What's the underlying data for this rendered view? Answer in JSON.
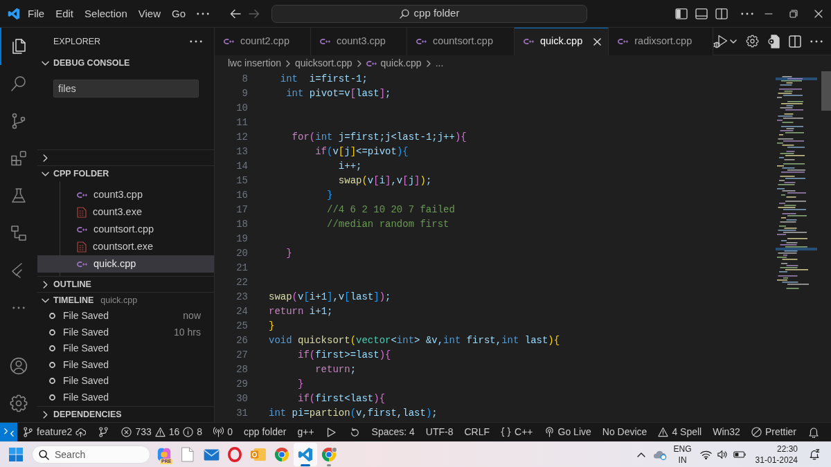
{
  "title_bar": {
    "menu": [
      "File",
      "Edit",
      "Selection",
      "View",
      "Go"
    ],
    "back": {
      "disabled": false
    },
    "forward": {
      "disabled": true
    },
    "command_center": "cpp folder"
  },
  "activity_bar": [
    {
      "selected": true
    },
    {
      "selected": false
    },
    {
      "selected": false
    },
    {
      "selected": false
    },
    {
      "selected": false
    },
    {
      "selected": false
    },
    {
      "selected": false
    }
  ],
  "sidebar": {
    "title": "EXPLORER",
    "sections": [
      {
        "title": "DEBUG CONSOLE",
        "expanded": true,
        "filter": "files"
      },
      {
        "expanded": false
      },
      {
        "title": "CPP FOLDER",
        "expanded": true,
        "files": [
          {
            "name": "count3.cpp",
            "kind": "source",
            "selected": false
          },
          {
            "name": "count3.exe",
            "kind": "binary",
            "selected": false
          },
          {
            "name": "countsort.cpp",
            "kind": "source",
            "selected": false
          },
          {
            "name": "countsort.exe",
            "kind": "binary",
            "selected": false
          },
          {
            "name": "quick.cpp",
            "kind": "source",
            "selected": true
          }
        ]
      },
      {
        "title": "OUTLINE",
        "expanded": false
      },
      {
        "title": "TIMELINE",
        "subtitle": "quick.cpp",
        "expanded": true,
        "entries": [
          {
            "label": "File Saved",
            "time": "now"
          },
          {
            "label": "File Saved",
            "time": "10 hrs"
          },
          {
            "label": "File Saved"
          },
          {
            "label": "File Saved"
          },
          {
            "label": "File Saved"
          },
          {
            "label": "File Saved"
          }
        ]
      },
      {
        "title": "DEPENDENCIES",
        "expanded": false
      }
    ]
  },
  "editor": {
    "tabs": [
      {
        "name": "count2.cpp",
        "selected": false
      },
      {
        "name": "count3.cpp",
        "selected": false
      },
      {
        "name": "countsort.cpp",
        "selected": false
      },
      {
        "name": "quick.cpp",
        "selected": true
      },
      {
        "name": "radixsort.cpp",
        "selected": false
      }
    ],
    "breadcrumb": [
      {
        "kind": "folder",
        "text": "lwc insertion"
      },
      {
        "kind": "folder",
        "text": "quicksort.cpp"
      },
      {
        "kind": "file",
        "text": "quick.cpp"
      },
      {
        "kind": "more",
        "text": "..."
      }
    ],
    "lines": [
      {
        "number": "8",
        "tokens": [
          {
            "kind": "type",
            "text": "  int"
          },
          {
            "kind": "var",
            "text": "  i=first-1;"
          }
        ]
      },
      {
        "number": "9",
        "tokens": [
          {
            "kind": "type",
            "text": "   int"
          },
          {
            "kind": "var",
            "text": " pivot=v"
          },
          {
            "kind": "bracket2",
            "text": "["
          },
          {
            "kind": "var",
            "text": "last"
          },
          {
            "kind": "bracket2",
            "text": "]"
          },
          {
            "kind": "var",
            "text": ";"
          }
        ]
      },
      {
        "number": "10"
      },
      {
        "number": "11"
      },
      {
        "number": "12",
        "tokens": [
          {
            "kind": "keyword",
            "text": "    for"
          },
          {
            "kind": "bracket2",
            "text": "("
          },
          {
            "kind": "type",
            "text": "int"
          },
          {
            "kind": "var",
            "text": " j=first;j<last-1;j++"
          },
          {
            "kind": "bracket2",
            "text": "){"
          }
        ]
      },
      {
        "number": "13",
        "tokens": [
          {
            "kind": "keyword",
            "text": "        if"
          },
          {
            "kind": "bracket3",
            "text": "("
          },
          {
            "kind": "var",
            "text": "v"
          },
          {
            "kind": "bracket1",
            "text": "["
          },
          {
            "kind": "var",
            "text": "j"
          },
          {
            "kind": "bracket1",
            "text": "]"
          },
          {
            "kind": "var",
            "text": "<=pivot"
          },
          {
            "kind": "bracket3",
            "text": "){"
          }
        ]
      },
      {
        "number": "14",
        "tokens": [
          {
            "kind": "var",
            "text": "            i++;"
          }
        ]
      },
      {
        "number": "15",
        "tokens": [
          {
            "kind": "function",
            "text": "            swap"
          },
          {
            "kind": "bracket1",
            "text": "("
          },
          {
            "kind": "var",
            "text": "v"
          },
          {
            "kind": "bracket2",
            "text": "["
          },
          {
            "kind": "var",
            "text": "i"
          },
          {
            "kind": "bracket2",
            "text": "]"
          },
          {
            "kind": "var",
            "text": ",v"
          },
          {
            "kind": "bracket2",
            "text": "["
          },
          {
            "kind": "var",
            "text": "j"
          },
          {
            "kind": "bracket2",
            "text": "]"
          },
          {
            "kind": "bracket1",
            "text": ")"
          },
          {
            "kind": "var",
            "text": ";"
          }
        ]
      },
      {
        "number": "16",
        "tokens": [
          {
            "kind": "bracket3",
            "text": "          }"
          }
        ]
      },
      {
        "number": "17",
        "tokens": [
          {
            "kind": "comment",
            "text": "          //4 6 2 10 20 7 failed"
          }
        ]
      },
      {
        "number": "18",
        "tokens": [
          {
            "kind": "comment",
            "text": "          //median random first"
          }
        ]
      },
      {
        "number": "19"
      },
      {
        "number": "20",
        "tokens": [
          {
            "kind": "bracket2",
            "text": "   }"
          }
        ]
      },
      {
        "number": "21"
      },
      {
        "number": "22"
      },
      {
        "number": "23",
        "tokens": [
          {
            "kind": "function",
            "text": "swap"
          },
          {
            "kind": "bracket2",
            "text": "("
          },
          {
            "kind": "var",
            "text": "v"
          },
          {
            "kind": "bracket3",
            "text": "["
          },
          {
            "kind": "var",
            "text": "i+1"
          },
          {
            "kind": "bracket3",
            "text": "]"
          },
          {
            "kind": "var",
            "text": ",v"
          },
          {
            "kind": "bracket3",
            "text": "["
          },
          {
            "kind": "var",
            "text": "last"
          },
          {
            "kind": "bracket3",
            "text": "]"
          },
          {
            "kind": "bracket2",
            "text": ")"
          },
          {
            "kind": "var",
            "text": ";"
          }
        ]
      },
      {
        "number": "24",
        "tokens": [
          {
            "kind": "keyword",
            "text": "return"
          },
          {
            "kind": "var",
            "text": " i+1;"
          }
        ]
      },
      {
        "number": "25",
        "tokens": [
          {
            "kind": "bracket1",
            "text": "}"
          }
        ]
      },
      {
        "number": "26",
        "tokens": [
          {
            "kind": "type",
            "text": "void"
          },
          {
            "kind": "function",
            "text": " quicksort"
          },
          {
            "kind": "bracket1",
            "text": "("
          },
          {
            "kind": "class",
            "text": "vector"
          },
          {
            "kind": "var",
            "text": "<"
          },
          {
            "kind": "type",
            "text": "int"
          },
          {
            "kind": "var",
            "text": "> &v,"
          },
          {
            "kind": "type",
            "text": "int"
          },
          {
            "kind": "var",
            "text": " first,"
          },
          {
            "kind": "type",
            "text": "int"
          },
          {
            "kind": "var",
            "text": " last"
          },
          {
            "kind": "bracket1",
            "text": "){"
          }
        ]
      },
      {
        "number": "27",
        "tokens": [
          {
            "kind": "keyword",
            "text": "     if"
          },
          {
            "kind": "bracket2",
            "text": "("
          },
          {
            "kind": "var",
            "text": "first>=last"
          },
          {
            "kind": "bracket2",
            "text": "){"
          }
        ]
      },
      {
        "number": "28",
        "tokens": [
          {
            "kind": "keyword",
            "text": "        return"
          },
          {
            "kind": "var",
            "text": ";"
          }
        ]
      },
      {
        "number": "29",
        "tokens": [
          {
            "kind": "bracket2",
            "text": "     }"
          }
        ]
      },
      {
        "number": "30",
        "tokens": [
          {
            "kind": "keyword",
            "text": "     if"
          },
          {
            "kind": "bracket2",
            "text": "("
          },
          {
            "kind": "var",
            "text": "first<last"
          },
          {
            "kind": "bracket2",
            "text": "){"
          }
        ]
      },
      {
        "number": "31",
        "tokens": [
          {
            "kind": "type",
            "text": "int"
          },
          {
            "kind": "var",
            "text": " pi="
          },
          {
            "kind": "function",
            "text": "partion"
          },
          {
            "kind": "bracket3",
            "text": "("
          },
          {
            "kind": "var",
            "text": "v,first,last"
          },
          {
            "kind": "bracket3",
            "text": ")"
          },
          {
            "kind": "var",
            "text": ";"
          }
        ]
      }
    ]
  },
  "status_bar": {
    "branch": "feature2",
    "errors": "733",
    "warnings": "16",
    "infos": "8",
    "ports": "0",
    "folder": "cpp folder",
    "compiler": "g++",
    "indentation": "Spaces: 4",
    "encoding": "UTF-8",
    "line_ending": "CRLF",
    "language": "C++",
    "live_server": "Go Live",
    "device": "No Device",
    "spell_check": "4 Spell",
    "platform": "Win32",
    "formatter": "Prettier"
  },
  "taskbar": {
    "search_placeholder": "Search",
    "apps": [
      {
        "badge": "PRE",
        "selected": false,
        "running": false
      },
      {
        "selected": false,
        "running": false
      },
      {
        "selected": false,
        "running": false
      },
      {
        "selected": false,
        "running": false
      },
      {
        "selected": false,
        "running": false
      },
      {
        "selected": false,
        "running": false
      },
      {
        "selected": true,
        "running": true
      },
      {
        "selected": false,
        "running": true
      }
    ],
    "tray": {
      "language": "ENG",
      "region": "IN",
      "time": "22:30",
      "date": "31-01-2024"
    }
  }
}
